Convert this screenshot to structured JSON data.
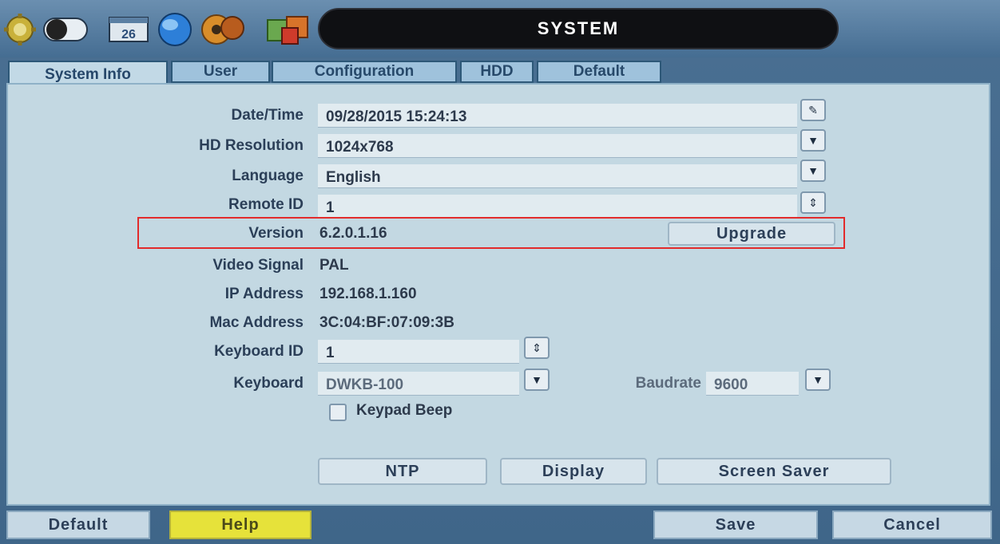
{
  "window": {
    "title": "SYSTEM"
  },
  "toolbar_icons": [
    "gear-icon",
    "toggle-icon",
    "calendar-icon",
    "globe-icon",
    "disc-icon",
    "puzzle-icon"
  ],
  "calendar_icon_text": "26",
  "tabs": [
    {
      "label": "System Info",
      "active": true
    },
    {
      "label": "User",
      "active": false
    },
    {
      "label": "Configuration",
      "active": false
    },
    {
      "label": "HDD",
      "active": false
    },
    {
      "label": "Default",
      "active": false
    }
  ],
  "form": {
    "datetime": {
      "label": "Date/Time",
      "value": "09/28/2015 15:24:13"
    },
    "hd_resolution": {
      "label": "HD Resolution",
      "value": "1024x768"
    },
    "language": {
      "label": "Language",
      "value": "English"
    },
    "remote_id": {
      "label": "Remote ID",
      "value": "1"
    },
    "version": {
      "label": "Version",
      "value": "6.2.0.1.16",
      "button": "Upgrade"
    },
    "video_signal": {
      "label": "Video Signal",
      "value": "PAL"
    },
    "ip_address": {
      "label": "IP Address",
      "value": "192.168.1.160"
    },
    "mac_address": {
      "label": "Mac Address",
      "value": "3C:04:BF:07:09:3B"
    },
    "keyboard_id": {
      "label": "Keyboard ID",
      "value": "1"
    },
    "keyboard": {
      "label": "Keyboard",
      "value": "DWKB-100"
    },
    "baudrate": {
      "label": "Baudrate",
      "value": "9600"
    },
    "keypad_beep": {
      "label": "Keypad Beep",
      "checked": false
    }
  },
  "actions": {
    "ntp": "NTP",
    "display": "Display",
    "screen_saver": "Screen Saver"
  },
  "footer": {
    "default": "Default",
    "help": "Help",
    "save": "Save",
    "cancel": "Cancel"
  },
  "colors": {
    "highlight": "#e22b2b",
    "help_button": "#e6e23a",
    "title_bar": "#0f1013"
  }
}
